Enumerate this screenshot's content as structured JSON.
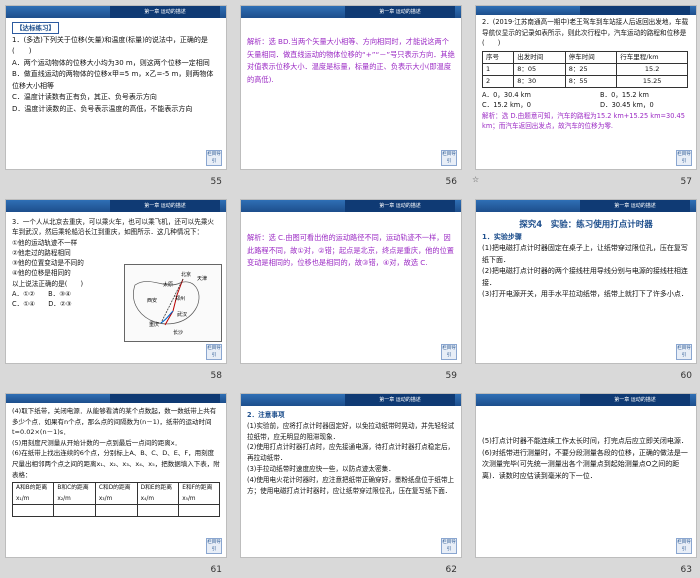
{
  "header_label": "第一章  运动的描述",
  "back_label": "栏目导引",
  "slides": [
    {
      "num": "55",
      "tag": "【达标练习】",
      "lines": [
        "1．(多选)下列关于位移(矢量)和温度(标量)的说法中，正确的是(　　)",
        "A．两个运动物体的位移大小均为30 m，则这两个位移一定相同",
        "B．做直线运动的两物体的位移x甲=5 m，x乙=-5 m，则两物体位移大小相等",
        "C．温度计读数有正有负，其正、负号表示方向",
        "D．温度计读数的正、负号表示温度的高低，不能表示方向"
      ]
    },
    {
      "num": "56",
      "lines": [
        "解析：选 BD.当两个矢量大小相等、方向相同时，才能说这两个矢量相同．做直线运动的物体位移的“+”“－”号只表示方向．其绝对值表示位移大小．温度是标量，标量的正、负表示大小(即温度的高低)."
      ]
    },
    {
      "num": "57",
      "lines": [
        "2．(2019·江苏南通高一期中)老王驾车到车站接人后返回出发地，车载导航仪显示的记录如表所示，则此次行程中，汽车运动的路程和位移是(　　)"
      ],
      "table": {
        "headers": [
          "序号",
          "出发时间",
          "停车时间",
          "行车里程/km"
        ],
        "rows": [
          [
            "1",
            "8：05",
            "8：25",
            "15.2"
          ],
          [
            "2",
            "8：30",
            "8：55",
            "15.25"
          ]
        ]
      },
      "options": [
        "A．0，30.4 km",
        "B．0，15.2 km",
        "C．15.2 km，0",
        "D．30.45 km，0"
      ],
      "answer": "解析：选 D.由题意可知，汽车的路程为15.2 km+15.25 km=30.45 km；而汽车返回出发点，故汽车的位移为零."
    },
    {
      "num": "58",
      "lines": [
        "3．一个人从北京去重庆，可以乘火车，也可以乘飞机，还可以先乘火车到武汉，然后乘轮船沿长江到重庆，如图所示．这几种情况下：",
        "①他的运动轨迹不一样",
        "②他走过的路程相同",
        "③他的位置变动是不同的",
        "④他的位移是相同的",
        "以上说法正确的是(　　)",
        "A．①②　　B．③④",
        "C．①④　　D．②③"
      ],
      "map": [
        "北京",
        "太原",
        "天津",
        "西安",
        "郑州",
        "重庆",
        "武汉",
        "长沙"
      ]
    },
    {
      "num": "59",
      "lines": [
        "解析：选 C.由图可看出他的运动路径不同，运动轨迹不一样，因此路程不同，故①对，②错；起点是北京，终点是重庆，他的位置变动是相同的，位移也是相同的，故③错，④对，故选 C."
      ]
    },
    {
      "num": "60",
      "title": "探究4　实验：练习使用打点计时器",
      "sub": "1．实验步骤",
      "lines": [
        "(1)把电磁打点计时器固定在桌子上，让纸带穿过限位孔，压在复写纸下面．",
        "(2)把电磁打点计时器的两个接线柱用导线分别与电源的接线柱相连接．",
        "(3)打开电源开关，用手水平拉动纸带，纸带上就打下了许多小点．"
      ]
    },
    {
      "num": "61",
      "lines": [
        "(4)取下纸带，关闭电源．从能够看清的某个点数起，数一数纸带上共有多少个点．如果有n个点，那么点的间隔数为(n－1)，纸带的运动时间t=0.02×(n－1)s．",
        "(5)用刻度尺测量从开始计数的一点到最后一点间的距离x．",
        "(6)在纸带上找出连续的6个点，分别标上A、B、C、D、E、F，用刻度尺量出相邻两个点之间的距离x₁、x₂、x₃、x₄、x₅，把数据填入下表，附表格："
      ],
      "table": {
        "headers": [
          "A和B的距离x₁/m",
          "B和C的距离x₂/m",
          "C和D的距离x₃/m",
          "D和E的距离x₄/m",
          "E和F的距离x₅/m"
        ],
        "rows": [
          [
            "",
            "",
            "",
            "",
            ""
          ]
        ]
      }
    },
    {
      "num": "62",
      "sub": "2．注意事项",
      "lines": [
        "(1)实验前，应将打点计时器固定好，以免拉动纸带时晃动，并先轻轻试拉纸带，应无明显的阻滞现象．",
        "(2)使用打点计时器打点时，应先接通电源，待打点计时器打点稳定后，再拉动纸带．",
        "(3)手拉动纸带时速度应快一些，以防点迹太密集．",
        "(4)使用电火花计时器时，应注意把纸带正确穿好，墨粉纸盘位于纸带上方；使用电磁打点计时器时，应让纸带穿过限位孔，压在复写纸下面．"
      ]
    },
    {
      "num": "63",
      "lines": [
        "(5)打点计时器不能连续工作太长时间，打完点后应立即关闭电源．",
        "(6)对纸带进行测量时，不要分段测量各段的位移，正确的做法是一次测量完毕(可先统一测量出各个测量点到起始测量点O之间的距离)．读数时应估读到毫米的下一位．"
      ]
    }
  ],
  "star_note": "☆"
}
